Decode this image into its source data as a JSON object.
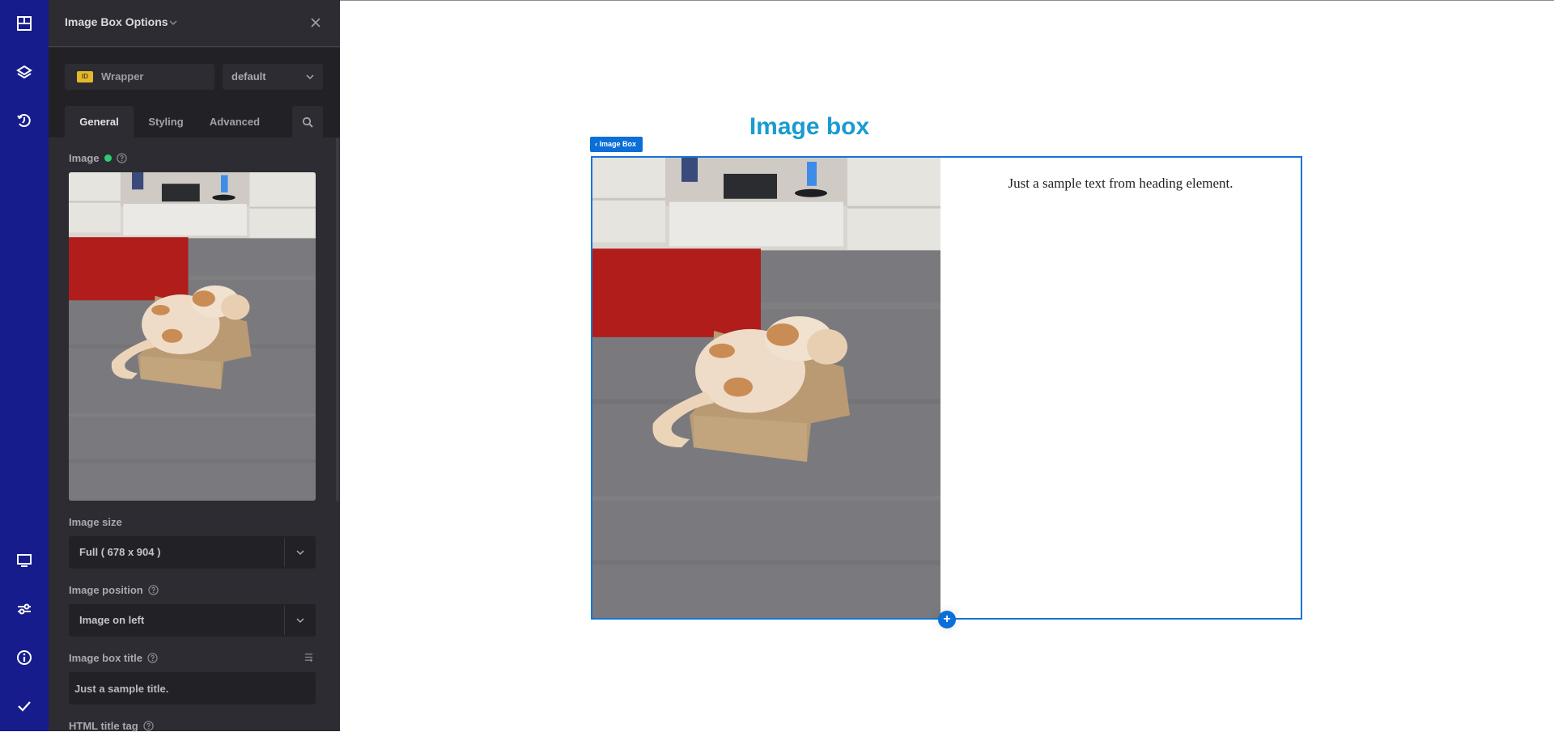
{
  "sidebar": {
    "top_icons": [
      "elements-icon",
      "layers-icon",
      "history-icon"
    ],
    "bottom_icons": [
      "responsive-icon",
      "settings-icon",
      "info-icon",
      "save-check-icon"
    ],
    "color": "#161c8c"
  },
  "panel": {
    "title": "Image Box Options",
    "id_badge": "ID",
    "wrapper_name": "Wrapper",
    "preset": "default",
    "tabs": [
      {
        "label": "General",
        "active": true
      },
      {
        "label": "Styling",
        "active": false
      },
      {
        "label": "Advanced",
        "active": false
      }
    ],
    "fields": {
      "image_label": "Image",
      "image_status_color": "#2ecc71",
      "image_size_label": "Image size",
      "image_size_value": "Full ( 678 x 904 )",
      "image_position_label": "Image position",
      "image_position_value": "Image on left",
      "title_label": "Image box title",
      "title_value": "Just a sample title.",
      "html_tag_label": "HTML title tag"
    }
  },
  "canvas": {
    "heading": "Image box",
    "heading_color": "#1a9bd0",
    "element_badge": "Image Box",
    "box_text": "Just a sample text from heading element.",
    "accent_color": "#0a6fd6",
    "add_button": "+"
  }
}
